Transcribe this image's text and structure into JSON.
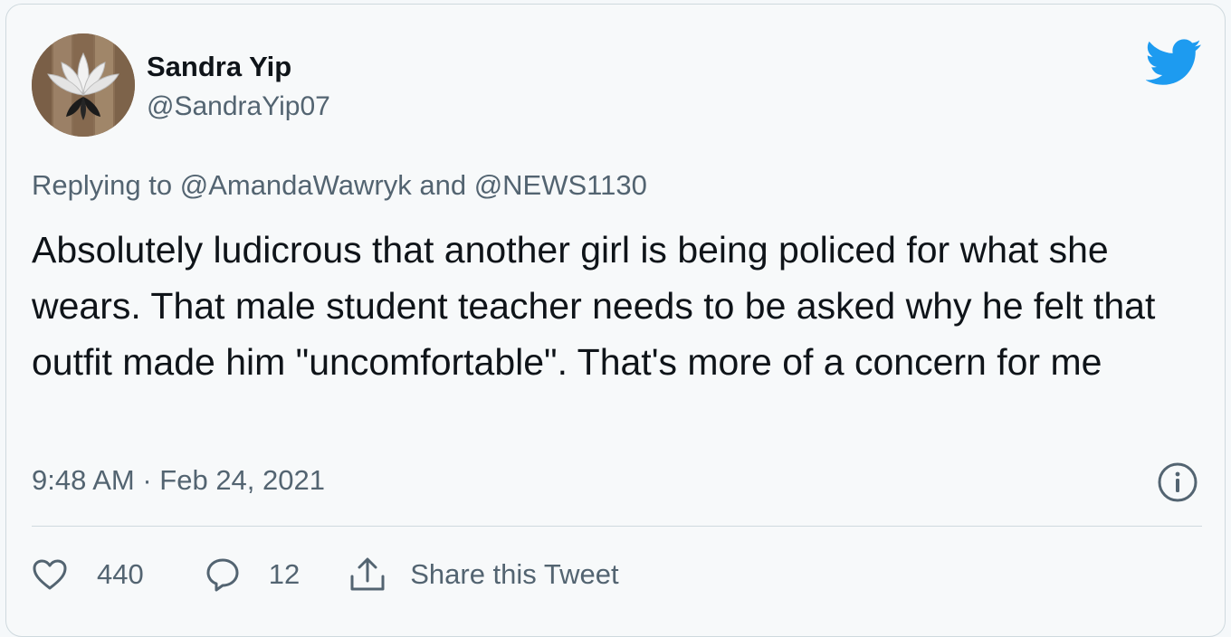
{
  "author": {
    "name": "Sandra Yip",
    "handle": "@SandraYip07"
  },
  "reply_context": {
    "prefix": "Replying to",
    "mention_1": "@AmandaWawryk",
    "conjunction": "and",
    "mention_2": "@NEWS1130"
  },
  "tweet": {
    "text": "Absolutely ludicrous that another girl is being policed for what she wears. That male student teacher needs to be asked why he felt that outfit made him \"uncomfortable\". That's more of a concern for me",
    "timestamp": "9:48 AM · Feb 24, 2021"
  },
  "actions": {
    "like_count": "440",
    "reply_count": "12",
    "share_label": "Share this Tweet"
  },
  "icons": {
    "brand": "twitter-bird-icon",
    "info": "info-icon",
    "like": "heart-icon",
    "reply": "speech-bubble-icon",
    "share": "share-icon"
  },
  "colors": {
    "brand_blue": "#1d9bf0",
    "secondary_text": "#536471",
    "primary_text": "#0f1419",
    "card_background": "#f7f9fa"
  }
}
